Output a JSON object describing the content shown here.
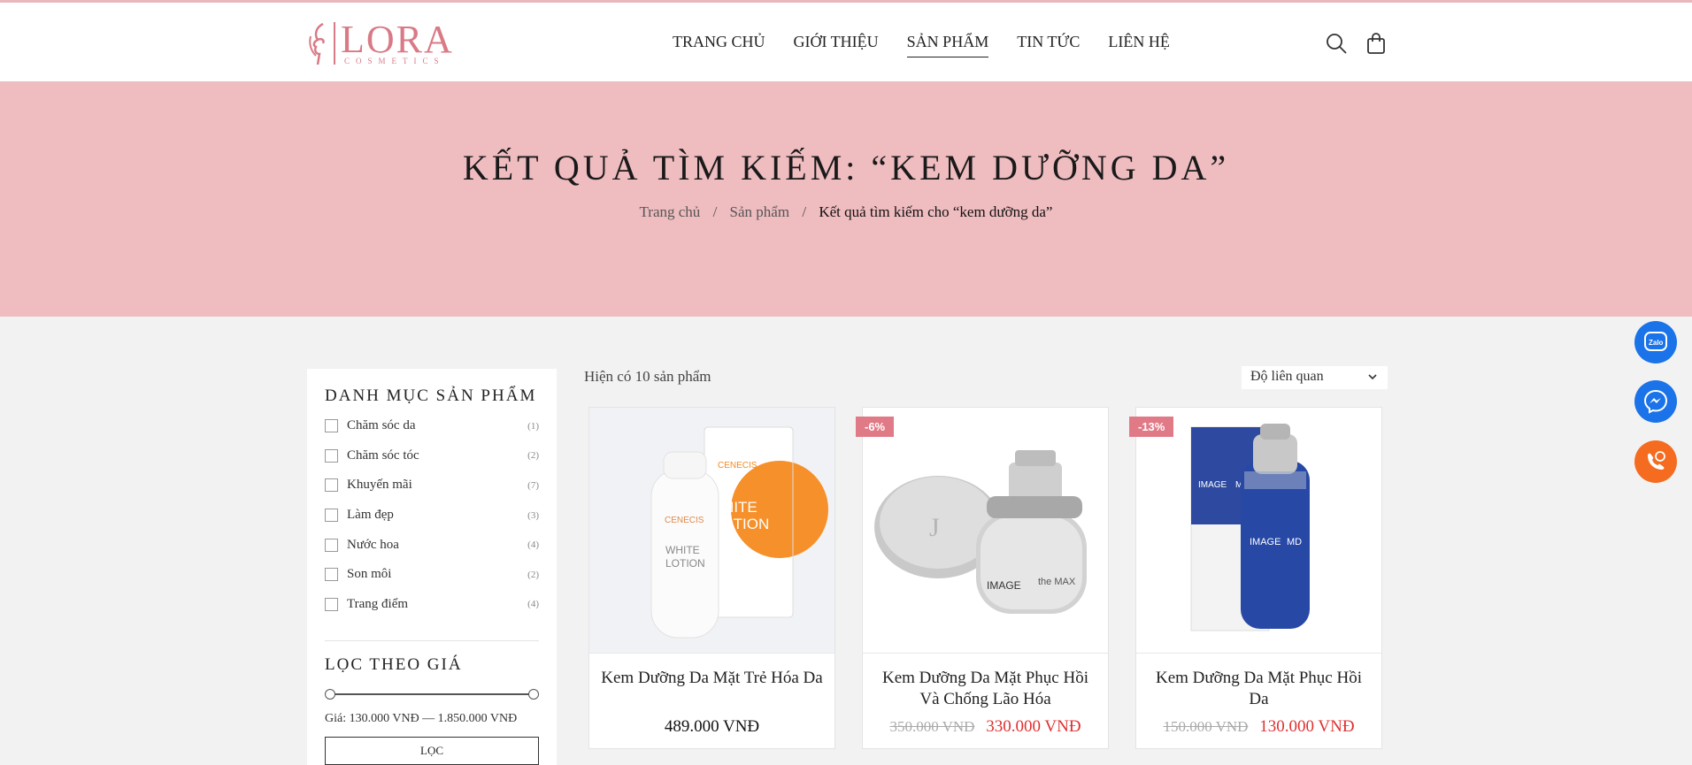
{
  "brand": {
    "name": "LORA",
    "tagline": "COSMETICS",
    "color": "#d97a86"
  },
  "nav": {
    "items": [
      {
        "label": "TRANG CHỦ"
      },
      {
        "label": "GIỚI THIỆU"
      },
      {
        "label": "SẢN PHẨM",
        "active": true
      },
      {
        "label": "TIN TỨC"
      },
      {
        "label": "LIÊN HỆ"
      }
    ],
    "icons": [
      "search-icon",
      "cart-icon"
    ]
  },
  "banner": {
    "title": "KẾT QUẢ TÌM KIẾM: “KEM DƯỠNG DA”",
    "breadcrumb": {
      "home": "Trang chủ",
      "products": "Sản phẩm",
      "current": "Kết quả tìm kiếm cho “kem dưỡng da”",
      "separator": "/"
    },
    "bg_color": "#efbcc0"
  },
  "sidebar": {
    "category_title": "DANH MỤC SẢN PHẨM",
    "categories": [
      {
        "label": "Chăm sóc da",
        "count": "(1)"
      },
      {
        "label": "Chăm sóc tóc",
        "count": "(2)"
      },
      {
        "label": "Khuyến mãi",
        "count": "(7)"
      },
      {
        "label": "Làm đẹp",
        "count": "(3)"
      },
      {
        "label": "Nước hoa",
        "count": "(4)"
      },
      {
        "label": "Son môi",
        "count": "(2)"
      },
      {
        "label": "Trang điểm",
        "count": "(4)"
      }
    ],
    "price_title": "LỌC THEO GIÁ",
    "price_text": "Giá: 130.000 VNĐ — 1.850.000 VNĐ",
    "filter_button": "LỌC"
  },
  "main": {
    "result_count": "Hiện có 10 sản phẩm",
    "sort_selected": "Độ liên quan",
    "products": [
      {
        "name": "Kem Dưỡng Da Mặt Trẻ Hóa Da",
        "price": "489.000 VNĐ",
        "old_price": "",
        "badge": ""
      },
      {
        "name": "Kem Dưỡng Da Mặt Phục Hồi Và Chống Lão Hóa",
        "price": "330.000 VNĐ",
        "old_price": "350.000 VNĐ",
        "badge": "-6%"
      },
      {
        "name": "Kem Dưỡng Da Mặt Phục Hồi Da",
        "price": "130.000 VNĐ",
        "old_price": "150.000 VNĐ",
        "badge": "-13%"
      }
    ],
    "product_image_text": {
      "p1_brand": "CENECIS",
      "p1_line1": "WHITE",
      "p1_line2": "LOTION",
      "p2_brand": "IMAGE",
      "p2_sub": "the MAX",
      "p3_brand": "IMAGE",
      "p3_sub": "MD"
    }
  },
  "floating": {
    "zalo_label": "Zalo",
    "icons": [
      "zalo-icon",
      "messenger-icon",
      "phone-icon"
    ]
  }
}
